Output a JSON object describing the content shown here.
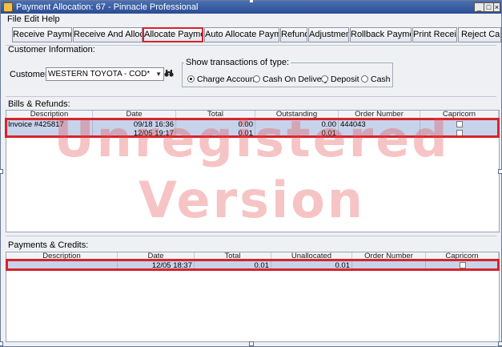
{
  "window": {
    "title": "Payment Allocation: 67 - Pinnacle Professional",
    "controls": {
      "minimize": "_",
      "maximize": "□",
      "close": "×"
    }
  },
  "menu": [
    "File",
    "Edit",
    "Help"
  ],
  "toolbar": {
    "buttons": [
      "Receive Payment",
      "Receive And Allocate",
      "Allocate Payment",
      "Auto Allocate Payment",
      "Refund",
      "Adjustment",
      "Rollback Payment",
      "Print Receipt",
      "Reject Capric"
    ],
    "active": "Allocate Payment"
  },
  "customer_info": {
    "section_label": "Customer Information:",
    "customer_label": "Customer:",
    "customer_value": "WESTERN TOYOTA - COD*",
    "find_icon": "binoculars-icon"
  },
  "transactions": {
    "group_label": "Show transactions of type:",
    "options": [
      "Charge Account",
      "Cash On Delivery",
      "Deposit",
      "Cash"
    ],
    "selected": "Charge Account"
  },
  "bills": {
    "section_label": "Bills & Refunds:",
    "columns": [
      "Description",
      "Date",
      "Total",
      "Outstanding",
      "Order Number",
      "Capricorn"
    ],
    "rows": [
      {
        "description": "Invoice #425817",
        "date": "09/18 16:36",
        "total": "0.00",
        "outstanding": "0.00",
        "order_number": "444043",
        "capricorn": false
      },
      {
        "description": "",
        "date": "12/05 19:17",
        "total": "0.01",
        "outstanding": "0.01",
        "order_number": "",
        "capricorn": false
      }
    ]
  },
  "payments": {
    "section_label": "Payments & Credits:",
    "columns": [
      "Description",
      "Date",
      "Total",
      "Unallocated",
      "Order Number",
      "Capricorn"
    ],
    "rows": [
      {
        "description": "",
        "date": "12/05 18:37",
        "total": "0.01",
        "unallocated": "0.01",
        "order_number": "",
        "capricorn": false
      }
    ]
  },
  "watermark": {
    "line1": "Unregistered",
    "line2": "Version"
  },
  "colors": {
    "highlight": "#d8232a",
    "selected_row": "#c7d3ea",
    "titlebar": "#2a4d93",
    "watermark": "#e24646"
  }
}
